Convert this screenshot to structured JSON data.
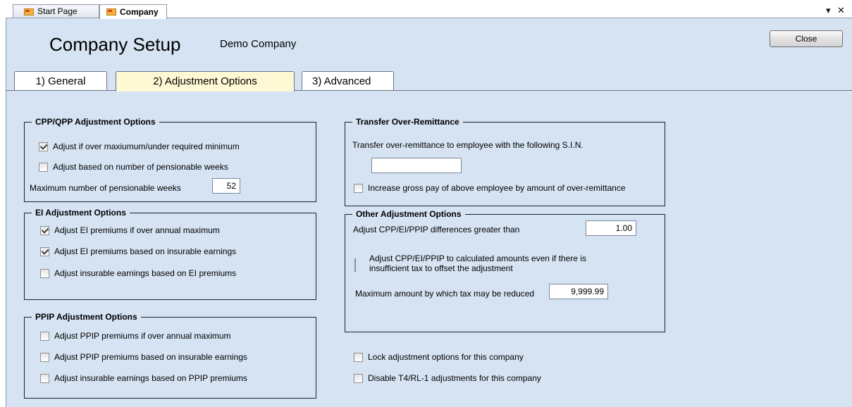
{
  "doc_tabs": [
    {
      "label": "Start Page"
    },
    {
      "label": "Company"
    }
  ],
  "window_controls": {
    "dropdown": "▾",
    "close": "✕"
  },
  "header": {
    "title": "Company Setup",
    "company": "Demo Company",
    "close_label": "Close"
  },
  "settings_tabs": [
    {
      "label": "1) General",
      "selected": false
    },
    {
      "label": "2) Adjustment Options",
      "selected": true
    },
    {
      "label": "3) Advanced",
      "selected": false
    }
  ],
  "cpp": {
    "title": "CPP/QPP Adjustment Options",
    "items": [
      {
        "label": "Adjust if over maxiumum/under required minimum",
        "checked": true
      },
      {
        "label": "Adjust based on number of pensionable weeks",
        "checked": false
      }
    ],
    "max_weeks_label": "Maximum number of pensionable weeks",
    "max_weeks_value": "52"
  },
  "ei": {
    "title": "EI Adjustment Options",
    "items": [
      {
        "label": "Adjust EI premiums if over annual maximum",
        "checked": true
      },
      {
        "label": "Adjust EI premiums based on insurable earnings",
        "checked": true
      },
      {
        "label": "Adjust insurable earnings based on EI premiums",
        "checked": false
      }
    ]
  },
  "ppip": {
    "title": "PPIP Adjustment Options",
    "items": [
      {
        "label": "Adjust PPIP premiums if over annual maximum",
        "checked": false
      },
      {
        "label": "Adjust PPIP premiums based on insurable earnings",
        "checked": false
      },
      {
        "label": "Adjust insurable earnings based on PPIP premiums",
        "checked": false
      }
    ]
  },
  "transfer": {
    "title": "Transfer Over-Remittance",
    "desc": "Transfer over-remittance to employee with the following S.I.N.",
    "sin_value": "",
    "increase_label": "Increase gross pay of above employee by amount of over-remittance",
    "increase_checked": false
  },
  "other": {
    "title": "Other Adjustment Options",
    "diff_label": "Adjust CPP/EI/PPIP differences greater than",
    "diff_value": "1.00",
    "calc_label_1": "Adjust CPP/EI/PPIP to calculated amounts even if there is",
    "calc_label_2": "insufficient tax to offset the adjustment",
    "calc_checked": false,
    "max_tax_label": "Maximum amount by which tax may be reduced",
    "max_tax_value": "9,999.99"
  },
  "lock": {
    "label": "Lock adjustment options for this company",
    "checked": false
  },
  "disable": {
    "label": "Disable T4/RL-1 adjustments for this company",
    "checked": false
  }
}
